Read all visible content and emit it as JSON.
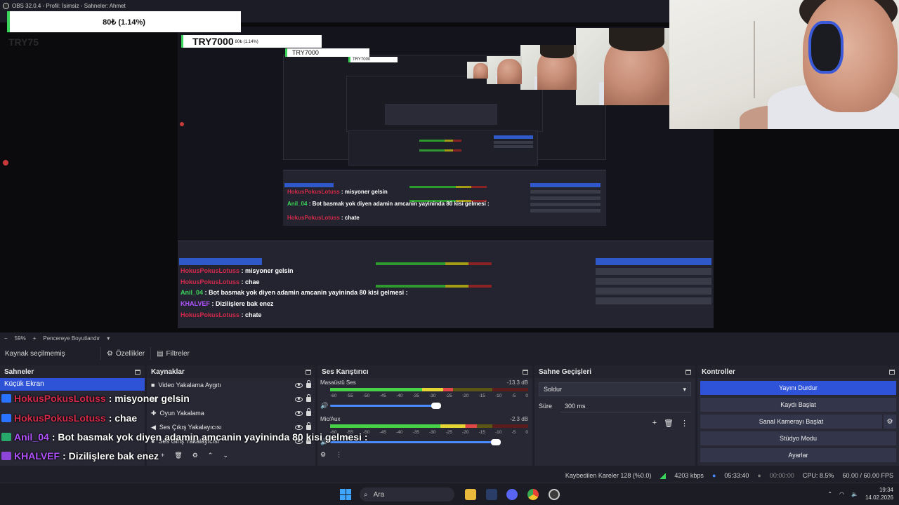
{
  "window": {
    "title": "OBS 32.0.4 - Profil: İsimsiz - Sahneler: Ahmet"
  },
  "donation": {
    "amount": "80₺ (1.14%)",
    "ghost_currency": "TRY75",
    "small_currency": "TRY7000",
    "small_amount": "80₺ (1.14%)"
  },
  "zoom": {
    "value": "59%",
    "mode": "Pencereye Boyutlandır"
  },
  "source_toolbar": {
    "label": "Kaynak seçilmemiş",
    "properties": "Özellikler",
    "filters": "Filtreler"
  },
  "scenes": {
    "title": "Sahneler",
    "items": [
      "Küçük Ekran"
    ]
  },
  "sources": {
    "title": "Kaynaklar",
    "items": [
      "Video Yakalama Aygıtı",
      "",
      "Oyun Yakalama",
      "Ses Çıkış Yakalayıcısı",
      "Ses Giriş Yakalayıcısı"
    ]
  },
  "mixer": {
    "title": "Ses Karıştırıcı",
    "channels": [
      {
        "name": "Masaüstü Ses",
        "db": "-13.3 dB",
        "level": 0.62,
        "volume": 0.6
      },
      {
        "name": "Mic/Aux",
        "db": "-2.3 dB",
        "level": 0.74,
        "volume": 0.88
      }
    ],
    "scale": [
      "-60",
      "-55",
      "-50",
      "-45",
      "-40",
      "-35",
      "-30",
      "-25",
      "-20",
      "-15",
      "-10",
      "-5",
      "0"
    ]
  },
  "transitions": {
    "title": "Sahne Geçişleri",
    "selected": "Soldur",
    "duration_label": "Süre",
    "duration_value": "300 ms"
  },
  "controls": {
    "title": "Kontroller",
    "stop_stream": "Yayını Durdur",
    "start_record": "Kaydı Başlat",
    "virtual_cam": "Sanal Kamerayı Başlat",
    "studio_mode": "Stüdyo Modu",
    "settings": "Ayarlar"
  },
  "status": {
    "dropped": "Kaybedilen Kareler 128 (%0.0)",
    "bitrate": "4203 kbps",
    "stream_time": "05:33:40",
    "record_time": "00:00:00",
    "cpu": "CPU: 8.5%",
    "fps": "60.00 / 60.00 FPS"
  },
  "chat": [
    {
      "user": "HokusPokusLotuss",
      "message": ": misyoner gelsin"
    },
    {
      "user": "HokusPokusLotuss",
      "message": ": chae"
    },
    {
      "user": "Anil_04",
      "message": ": Bot basmak yok diyen adamin amcanin yayininda 80 kisi gelmesi :"
    },
    {
      "user": "KHALVEF",
      "message": ": Dizilişlere bak enez"
    },
    {
      "user": "HokusPokusLotuss",
      "message": ": chate"
    }
  ],
  "taskbar": {
    "search": "Ara",
    "time": "19:34",
    "date": "14.02.2026"
  },
  "colors": {
    "accent": "#2f53d8",
    "meter_green": "#47d147",
    "meter_yellow": "#e3d634",
    "meter_red": "#e04848",
    "chat_red": "#d22a4a",
    "chat_purple": "#b152ff"
  }
}
